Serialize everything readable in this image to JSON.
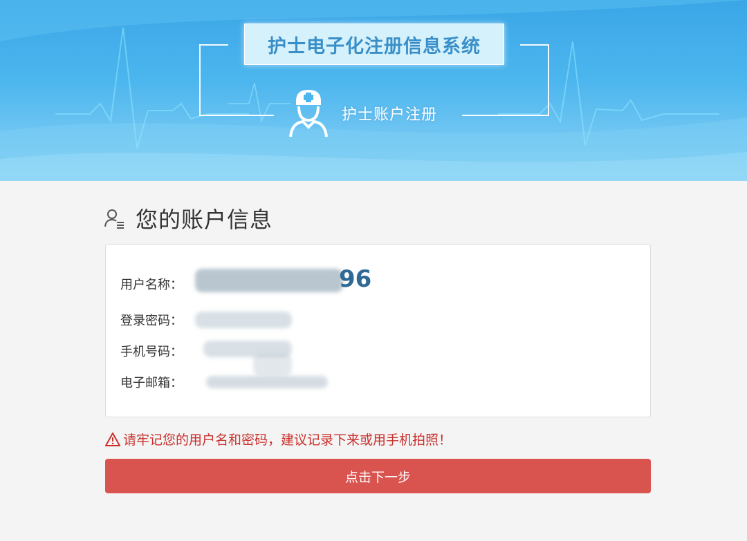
{
  "header": {
    "title": "护士电子化注册信息系统",
    "subtitle": "护士账户注册",
    "icon": "nurse-icon"
  },
  "account_info": {
    "section_title": "您的账户信息",
    "icon": "user-info-icon",
    "fields": {
      "username": {
        "label": "用户名称：",
        "visible_suffix": "96"
      },
      "password": {
        "label": "登录密码："
      },
      "phone": {
        "label": "手机号码："
      },
      "email": {
        "label": "电子邮箱："
      }
    }
  },
  "warning": {
    "icon": "warning-triangle-icon",
    "text": "请牢记您的用户名和密码，建议记录下来或用手机拍照！"
  },
  "actions": {
    "next_label": "点击下一步"
  },
  "colors": {
    "banner": "#3aa6e6",
    "title_text": "#3a8fc8",
    "button": "#d9534f",
    "warning": "#c9302c"
  }
}
